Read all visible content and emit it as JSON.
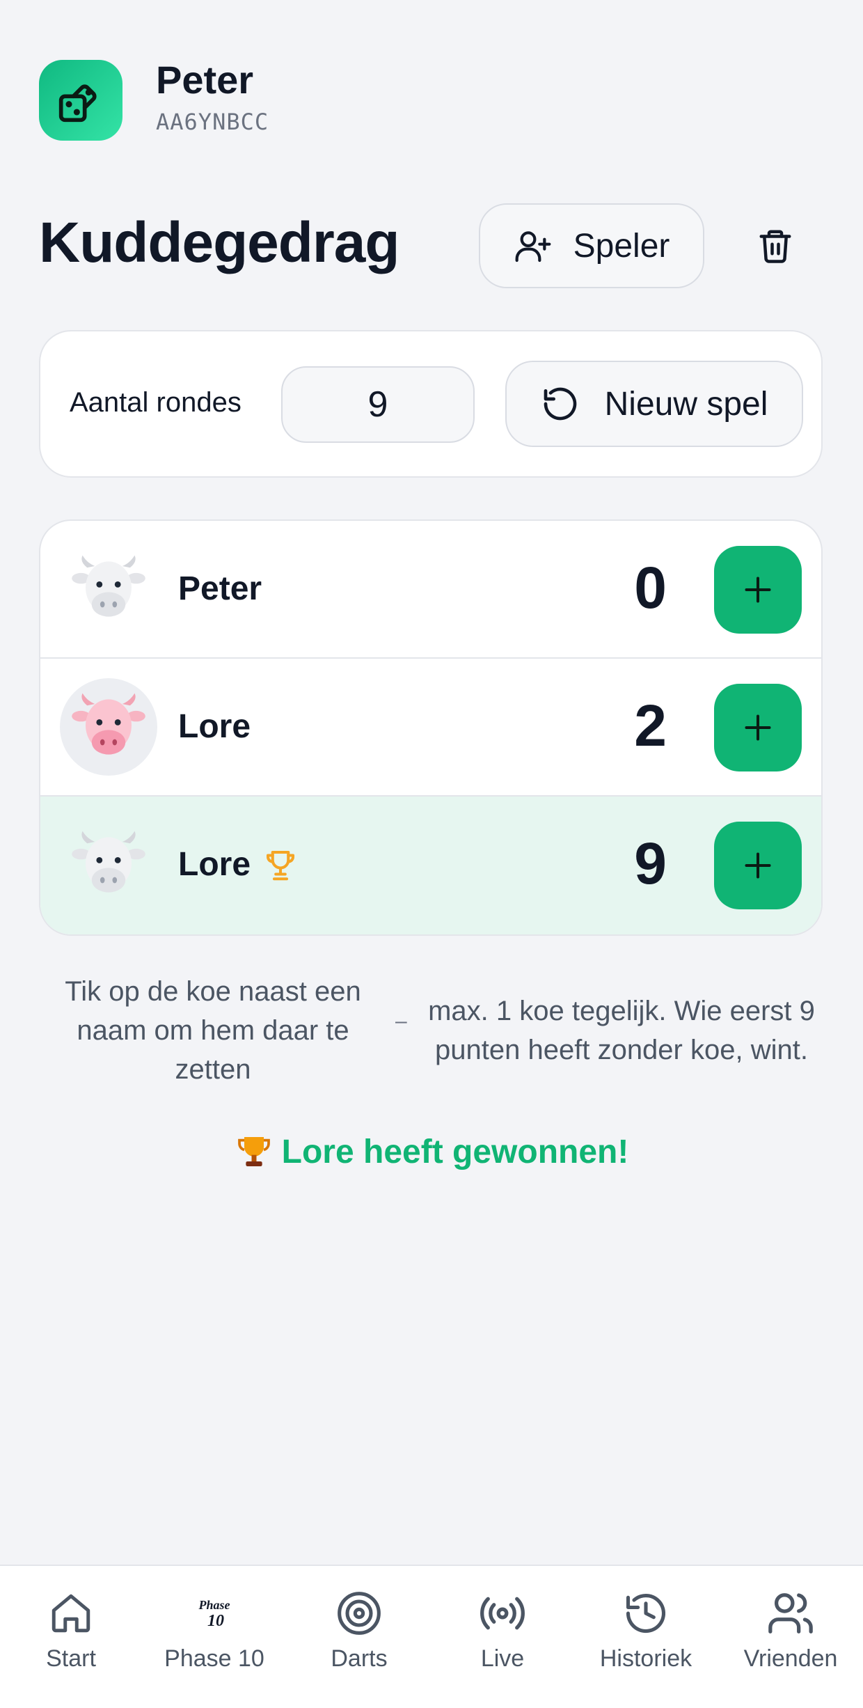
{
  "header": {
    "user_name": "Peter",
    "user_code": "AA6YNBCC",
    "logo_icon": "dice-icon"
  },
  "page": {
    "title": "Kuddegedrag",
    "add_player_label": "Speler",
    "delete_icon": "trash-icon"
  },
  "settings": {
    "rounds_label": "Aantal rondes",
    "rounds_value": "9",
    "new_game_label": "Nieuw spel"
  },
  "players": [
    {
      "name": "Peter",
      "score": "0",
      "cow_color": "white",
      "cow_active": false,
      "winner": false
    },
    {
      "name": "Lore",
      "score": "2",
      "cow_color": "pink",
      "cow_active": true,
      "winner": false
    },
    {
      "name": "Lore",
      "score": "9",
      "cow_color": "white",
      "cow_active": false,
      "winner": true
    }
  ],
  "hint": {
    "left": "Tik op de koe naast een naam om hem daar te zetten",
    "separator": "–",
    "right": "max. 1 koe tegelijk. Wie eerst 9 punten heeft zonder koe, wint."
  },
  "result": {
    "message": "Lore heeft gewonnen!"
  },
  "nav": {
    "items": [
      {
        "label": "Start",
        "icon": "home-icon"
      },
      {
        "label": "Phase 10",
        "icon": "phase10-logo-icon"
      },
      {
        "label": "Darts",
        "icon": "target-icon"
      },
      {
        "label": "Live",
        "icon": "broadcast-icon"
      },
      {
        "label": "Historiek",
        "icon": "history-icon"
      },
      {
        "label": "Vrienden",
        "icon": "users-icon"
      }
    ]
  },
  "colors": {
    "accent": "#10b474",
    "winner_row": "#e6f6f0",
    "trophy": "#f5a524",
    "background": "#f3f4f7"
  }
}
